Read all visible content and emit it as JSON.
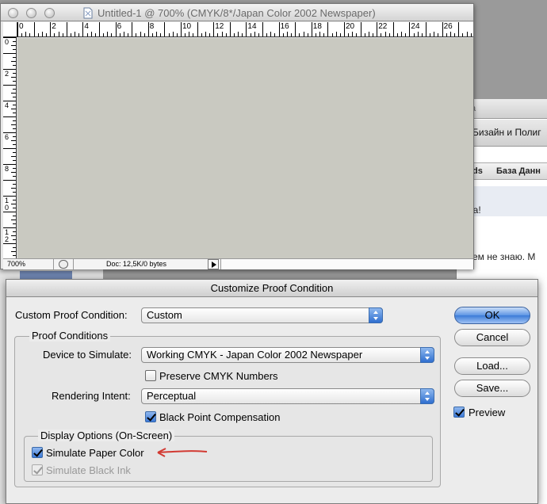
{
  "doc_window": {
    "title": "Untitled-1 @ 700% (CMYK/8*/Japan Color 2002 Newspaper)",
    "h_ruler_ticks": [
      "0",
      "2",
      "4",
      "6",
      "8",
      "10",
      "12",
      "14",
      "16",
      "18",
      "20",
      "22",
      "24",
      "26"
    ],
    "v_ruler_ticks": [
      "0",
      "2",
      "4",
      "6",
      "8",
      "1\n0",
      "1\n2"
    ],
    "zoom": "700%",
    "doc_info": "Doc: 12,5K/0 bytes",
    "canvas_color": "#c9c9c1"
  },
  "background_page": {
    "tab_title": "Бизайн и Полиг",
    "nav_items": [
      "ds",
      "База Данн"
    ],
    "line1": "ра!",
    "line2": "ем не знаю. М"
  },
  "dialog": {
    "title": "Customize Proof Condition",
    "custom_label": "Custom Proof Condition:",
    "custom_value": "Custom",
    "proof_group_title": "Proof Conditions",
    "device_label": "Device to Simulate:",
    "device_value": "Working CMYK - Japan Color 2002 Newspaper",
    "preserve_label": "Preserve CMYK Numbers",
    "preserve_checked": false,
    "intent_label": "Rendering Intent:",
    "intent_value": "Perceptual",
    "bpc_label": "Black Point Compensation",
    "bpc_checked": true,
    "display_group_title": "Display Options (On-Screen)",
    "paper_label": "Simulate Paper Color",
    "paper_checked": true,
    "ink_label": "Simulate Black Ink",
    "ink_checked": true,
    "ink_disabled": true,
    "ok_label": "OK",
    "cancel_label": "Cancel",
    "load_label": "Load...",
    "save_label": "Save...",
    "preview_label": "Preview",
    "preview_checked": true
  },
  "accent_color": "#3b7bd8",
  "annotation_arrow_color": "#d23a32"
}
